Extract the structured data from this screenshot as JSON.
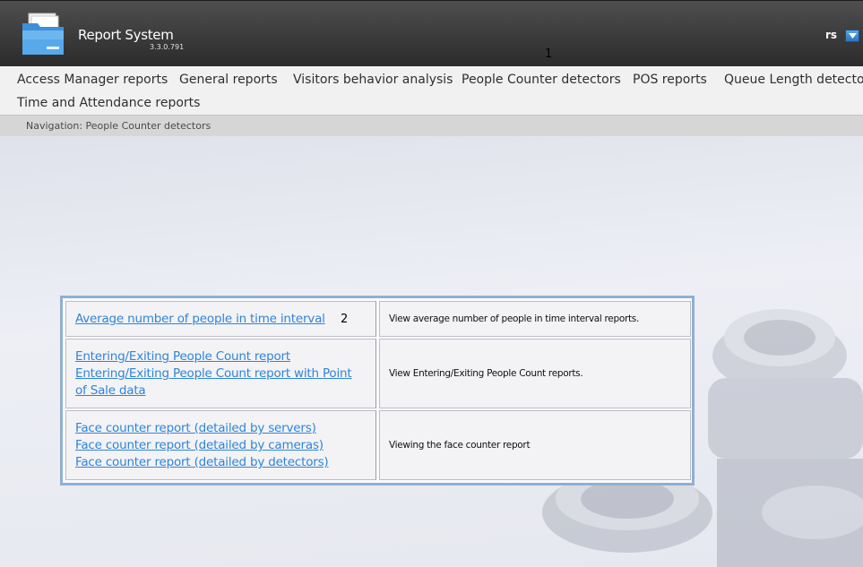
{
  "app": {
    "title": "Report System",
    "version": "3.3.0.791",
    "user": "rs"
  },
  "callouts": {
    "one": "1",
    "two": "2"
  },
  "nav": {
    "items": [
      "Access Manager reports",
      "General reports",
      "Visitors behavior analysis",
      "People Counter detectors",
      "POS reports",
      "Queue Length detectors",
      "Time and Attendance reports"
    ]
  },
  "breadcrumb": "Navigation: People Counter detectors",
  "reports": [
    {
      "links": [
        "Average number of people in time interval"
      ],
      "description": "View average number of people in time interval reports."
    },
    {
      "links": [
        "Entering/Exiting People Count report",
        "Entering/Exiting People Count report with Point of Sale data"
      ],
      "description": "View Entering/Exiting People Count reports."
    },
    {
      "links": [
        "Face counter report (detailed by servers)",
        "Face counter report (detailed by cameras)",
        "Face counter report (detailed by detectors)"
      ],
      "description": "Viewing the face counter report"
    }
  ],
  "icons": {
    "logo": "folder-icon",
    "user_menu": "dropdown-arrow-icon"
  },
  "colors": {
    "header_bg": "#3e3e3e",
    "link": "#2f84d8",
    "table_border": "#8fb0d4",
    "user_menu_button": "#2b74c2"
  }
}
